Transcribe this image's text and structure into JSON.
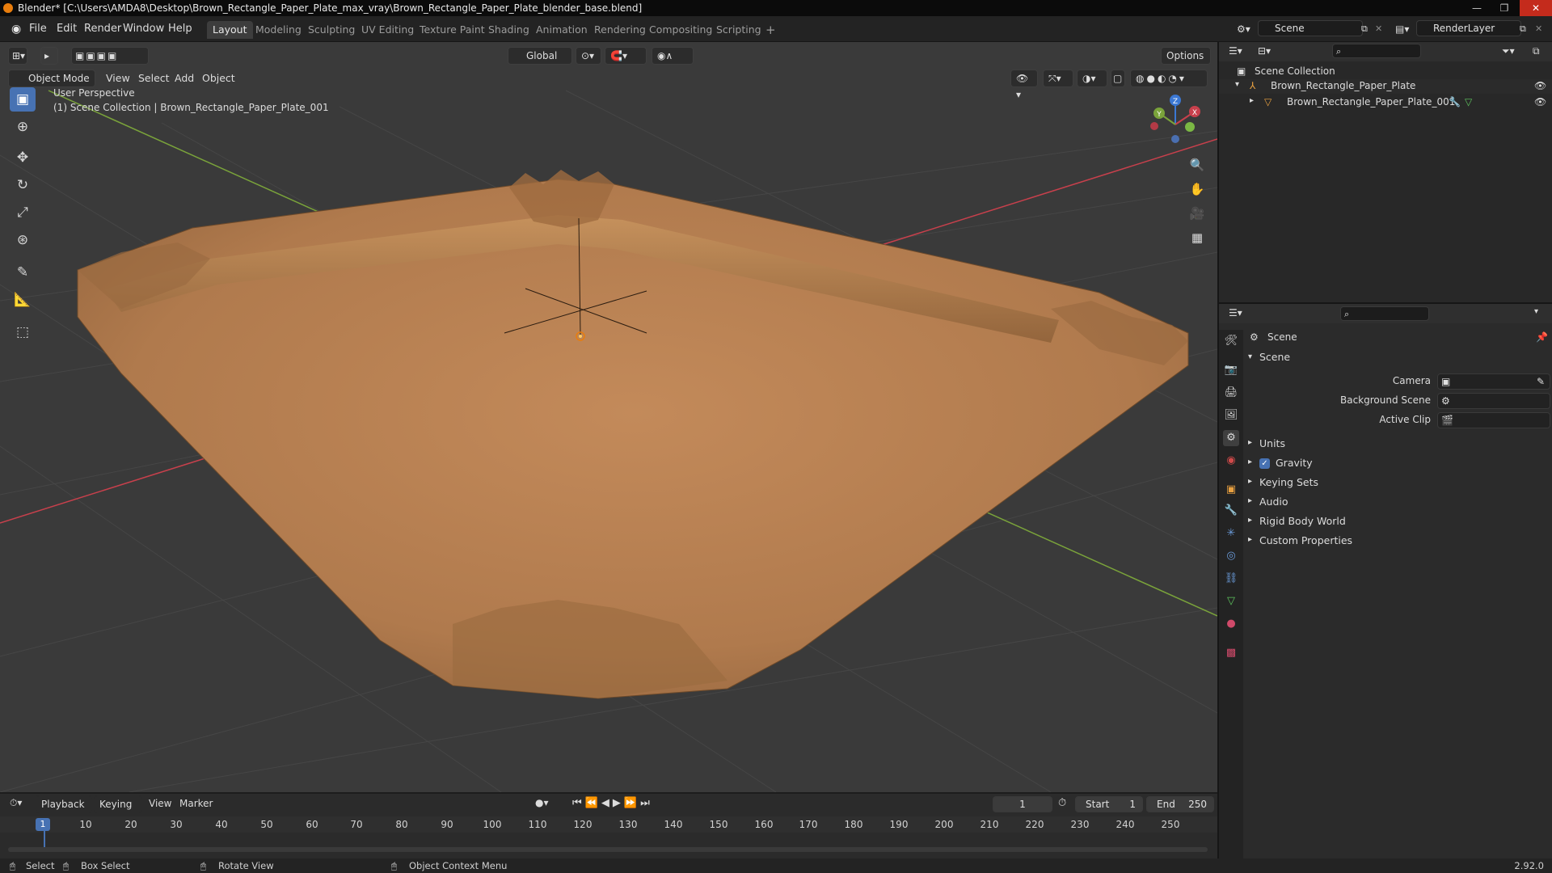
{
  "titlebar": {
    "title": "Blender* [C:\\Users\\AMDA8\\Desktop\\Brown_Rectangle_Paper_Plate_max_vray\\Brown_Rectangle_Paper_Plate_blender_base.blend]"
  },
  "menu": [
    "File",
    "Edit",
    "Render",
    "Window",
    "Help"
  ],
  "workspace_tabs": [
    "Layout",
    "Modeling",
    "Sculpting",
    "UV Editing",
    "Texture Paint",
    "Shading",
    "Animation",
    "Rendering",
    "Compositing",
    "Scripting"
  ],
  "scene_selector": {
    "value": "Scene"
  },
  "renderlayer_selector": {
    "value": "RenderLayer"
  },
  "viewport_header": {
    "mode": "Object Mode",
    "menus": [
      "View",
      "Select",
      "Add",
      "Object"
    ],
    "orientation": "Global",
    "options": "Options"
  },
  "viewport_overlay": {
    "perspective": "User Perspective",
    "context": "(1) Scene Collection | Brown_Rectangle_Paper_Plate_001"
  },
  "gizmo": {
    "x": "X",
    "y": "Y",
    "z": "Z"
  },
  "outliner": {
    "root": "Scene Collection",
    "items": [
      {
        "label": "Brown_Rectangle_Paper_Plate"
      },
      {
        "label": "Brown_Rectangle_Paper_Plate_001"
      }
    ]
  },
  "properties": {
    "context_title": "Scene",
    "panel_title": "Scene",
    "fields": [
      {
        "label": "Camera",
        "value": ""
      },
      {
        "label": "Background Scene",
        "value": ""
      },
      {
        "label": "Active Clip",
        "value": ""
      }
    ],
    "sections": [
      {
        "label": "Units",
        "checkbox": false
      },
      {
        "label": "Gravity",
        "checkbox": true
      },
      {
        "label": "Keying Sets",
        "checkbox": false
      },
      {
        "label": "Audio",
        "checkbox": false
      },
      {
        "label": "Rigid Body World",
        "checkbox": false
      },
      {
        "label": "Custom Properties",
        "checkbox": false
      }
    ]
  },
  "timeline": {
    "menus": [
      "Playback",
      "Keying",
      "View",
      "Marker"
    ],
    "current_frame": "1",
    "start_label": "Start",
    "start": "1",
    "end_label": "End",
    "end": "250",
    "ruler_current": "1",
    "ticks": [
      "10",
      "20",
      "30",
      "40",
      "50",
      "60",
      "70",
      "80",
      "90",
      "100",
      "110",
      "120",
      "130",
      "140",
      "150",
      "160",
      "170",
      "180",
      "190",
      "200",
      "210",
      "220",
      "230",
      "240",
      "250"
    ]
  },
  "statusbar": {
    "select": "Select",
    "box_select": "Box Select",
    "rotate_view": "Rotate View",
    "context_menu": "Object Context Menu",
    "version": "2.92.0"
  },
  "colors": {
    "accent": "#4772b3",
    "viewport_bg": "#3a3a3a",
    "plate": "#b67d4f",
    "x_axis": "#c8404c",
    "y_axis": "#7aa33a",
    "z_axis": "#3b78d4"
  }
}
